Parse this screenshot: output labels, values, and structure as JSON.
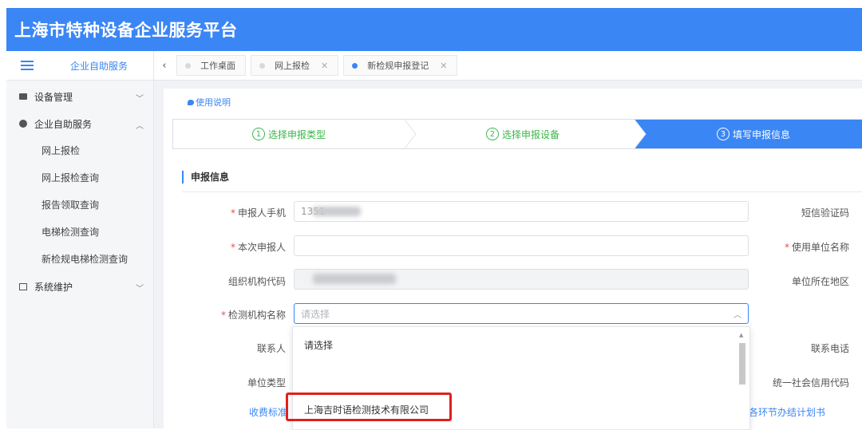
{
  "header": {
    "title": "上海市特种设备企业服务平台"
  },
  "sidebar": {
    "top_title": "企业自助服务",
    "groups": [
      {
        "label": "设备管理"
      },
      {
        "label": "企业自助服务",
        "items": [
          "网上报检",
          "网上报检查询",
          "报告领取查询",
          "电梯检测查询",
          "新检规电梯检测查询"
        ]
      },
      {
        "label": "系统维护"
      }
    ]
  },
  "tabs": [
    {
      "label": "工作桌面"
    },
    {
      "label": "网上报检"
    },
    {
      "label": "新检规申报登记"
    }
  ],
  "help_link": "使用说明",
  "steps": [
    {
      "num": "1",
      "label": "选择申报类型"
    },
    {
      "num": "2",
      "label": "选择申报设备"
    },
    {
      "num": "3",
      "label": "填写申报信息"
    }
  ],
  "section_title": "申报信息",
  "form": {
    "phone_label": "申报人手机",
    "phone_value": "1351",
    "sms_label": "短信验证码",
    "reporter_label": "本次申报人",
    "unit_name_label": "使用单位名称",
    "org_code_label": "组织机构代码",
    "region_label": "单位所在地区",
    "agency_label": "检测机构名称",
    "agency_placeholder": "请选择",
    "contact_label": "联系人",
    "contact_phone_label": "联系电话",
    "unit_type_label": "单位类型",
    "credit_code_label": "统一社会信用代码",
    "fee_link": "收费标准",
    "plan_link": "各环节办结计划书"
  },
  "dropdown": {
    "options": [
      "请选择",
      "上海吉时语检测技术有限公司"
    ]
  },
  "colors": {
    "brand": "#3a86f5",
    "required": "#f24949",
    "step_done": "#3bb64a",
    "highlight": "#e0201c"
  }
}
